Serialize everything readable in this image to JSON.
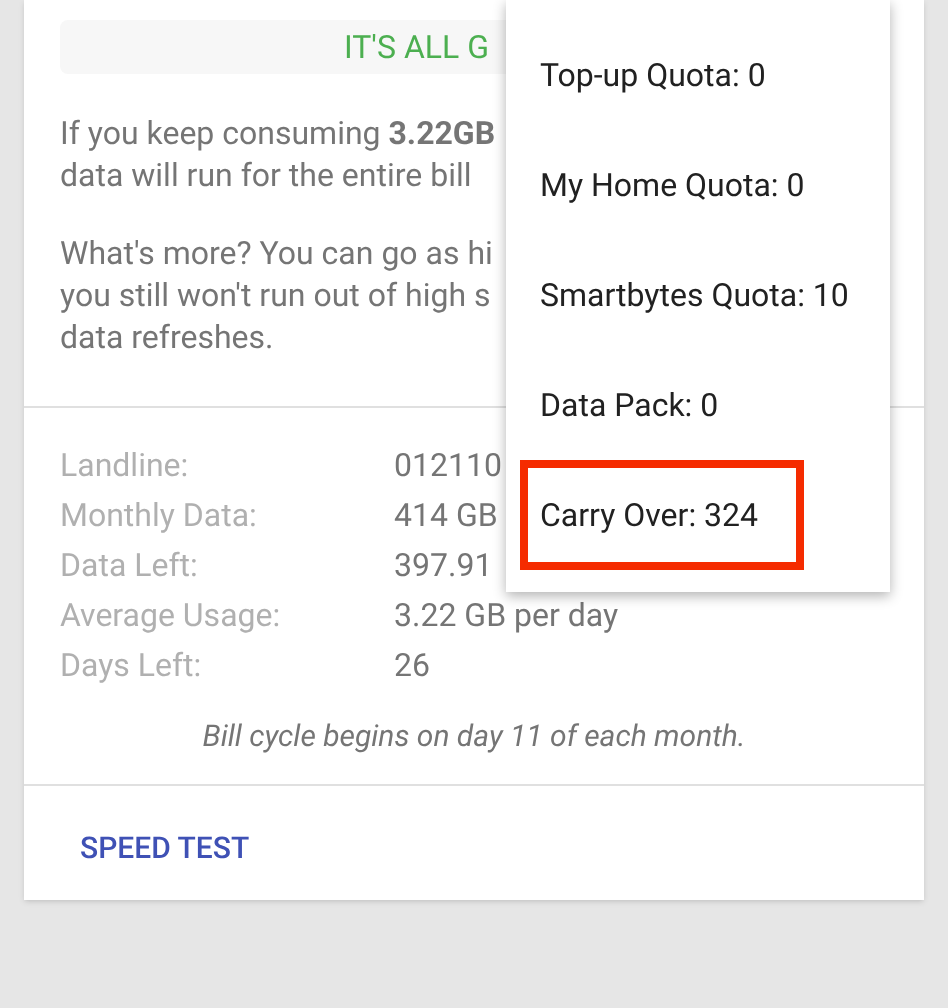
{
  "banner": {
    "text": "IT'S ALL G"
  },
  "paragraphs": [
    {
      "lines": [
        "If you keep consuming **3.22GB**",
        "data will run for the entire bill"
      ]
    },
    {
      "lines": [
        "What's more? You can go as hi",
        "you still won't run out of high s",
        "data refreshes."
      ]
    }
  ],
  "details": [
    {
      "label": "Landline:",
      "value": "012110"
    },
    {
      "label": "Monthly Data:",
      "value": "414 GB"
    },
    {
      "label": "Data Left:",
      "value": "397.91"
    },
    {
      "label": "Average Usage:",
      "value": "3.22 GB per day"
    },
    {
      "label": "Days Left:",
      "value": "26"
    }
  ],
  "note": "Bill cycle begins on day 11 of each month.",
  "action": {
    "label": "SPEED TEST"
  },
  "menu": {
    "items": [
      {
        "label": "Top-up Quota: 0",
        "highlighted": false
      },
      {
        "label": "My Home Quota: 0",
        "highlighted": false
      },
      {
        "label": "Smartbytes Quota: 10",
        "highlighted": false
      },
      {
        "label": "Data Pack: 0",
        "highlighted": false
      },
      {
        "label": "Carry Over: 324",
        "highlighted": true
      }
    ]
  }
}
